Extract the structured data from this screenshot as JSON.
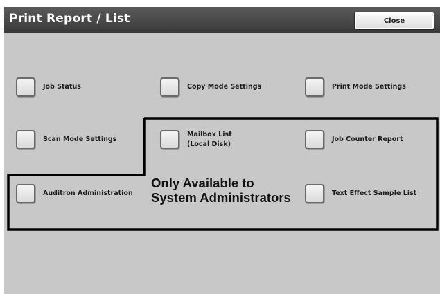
{
  "header": {
    "title": "Print Report / List",
    "close_label": "Close"
  },
  "options": [
    {
      "label": "Job Status"
    },
    {
      "label": "Copy Mode Settings"
    },
    {
      "label": "Print Mode Settings"
    },
    {
      "label": "Scan Mode Settings"
    },
    {
      "label_lines": [
        "Mailbox List",
        "(Local Disk)"
      ]
    },
    {
      "label": "Job Counter Report"
    },
    {
      "label": "Auditron Administration"
    },
    {
      "label": "Text Effect Sample List"
    }
  ],
  "admin_note": {
    "lines": [
      "Only Available to",
      "System Administrators"
    ]
  }
}
